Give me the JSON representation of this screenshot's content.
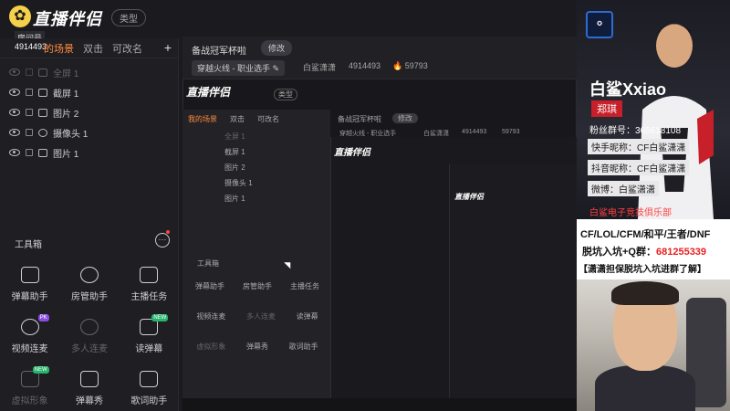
{
  "app": {
    "logo_text": "直播伴侣",
    "type_pill": "类型",
    "room_label": "房间号",
    "room_id": "4914493"
  },
  "left_tabs": [
    {
      "label": "的场景",
      "active": true
    },
    {
      "label": "双击",
      "active": false
    },
    {
      "label": "可改名",
      "active": false
    }
  ],
  "scene_items": [
    {
      "label": "全屏 1",
      "dim": true
    },
    {
      "label": "截屏 1",
      "dim": false
    },
    {
      "label": "图片 2",
      "dim": false
    },
    {
      "label": "摄像头 1",
      "dim": false
    },
    {
      "label": "图片 1",
      "dim": false
    }
  ],
  "toolbox": {
    "label": "工具箱",
    "more": "···",
    "tools": [
      {
        "label": "弹幕助手",
        "icon": "danmu-icon",
        "badge": ""
      },
      {
        "label": "房管助手",
        "icon": "manager-icon",
        "badge": ""
      },
      {
        "label": "主播任务",
        "icon": "task-icon",
        "badge": ""
      },
      {
        "label": "视频连麦",
        "icon": "video-link-icon",
        "badge": "PK"
      },
      {
        "label": "多人连麦",
        "icon": "multi-link-icon",
        "badge": "",
        "dim": true
      },
      {
        "label": "读弹幕",
        "icon": "read-danmu-icon",
        "badge": "NEW"
      },
      {
        "label": "虚拟形象",
        "icon": "avatar-icon",
        "badge": "NEW",
        "dim": true
      },
      {
        "label": "弹幕秀",
        "icon": "danmu-show-icon",
        "badge": ""
      },
      {
        "label": "歌词助手",
        "icon": "lyrics-icon",
        "badge": ""
      }
    ]
  },
  "main": {
    "title": "备战冠军杯啦",
    "edit_label": "修改",
    "category": "穿越火线 - 职业选手",
    "anchor": "白鲨潇潇",
    "room_id": "4914493",
    "popularity": "59793"
  },
  "nested": {
    "logo": "直播伴侣",
    "type_pill": "类型",
    "tabs": [
      "我的场景",
      "双击",
      "可改名"
    ],
    "scenes": [
      "全屏 1",
      "截屏 1",
      "图片 2",
      "摄像头 1",
      "图片 1"
    ],
    "toolbox": "工具箱",
    "tools": [
      "弹幕助手",
      "房管助手",
      "主播任务",
      "视频连麦",
      "多人连麦",
      "读弹幕",
      "虚拟形象",
      "弹幕秀",
      "歌词助手"
    ],
    "title": "备战冠军杯啦",
    "edit": "修改",
    "category": "穿越火线 - 职业选手",
    "anchor": "白鲨潇潇",
    "room_id": "4914493",
    "popularity": "59793"
  },
  "overlay": {
    "streamer_name": "白鲨Xxiao",
    "real_name": "郑琪",
    "fan_group": "粉丝群号：365618108",
    "kuaishou": "快手昵称：CF白鲨潇潇",
    "douyin": "抖音昵称：CF白鲨潇潇",
    "weibo": "微博：白鲨潇潇",
    "club": "白鲨电子竞技俱乐部",
    "promo_line1": "CF/LOL/CFM/和平/王者/DNF",
    "promo_line2_prefix": "脱坑入坑+Q群：",
    "promo_line2_qq": "681255339",
    "promo_line3": "【潇潇担保脱坑入坑进群了解】"
  },
  "colors": {
    "accent": "#ff8a3d",
    "red": "#e82020",
    "bg": "#1b1b1f"
  }
}
